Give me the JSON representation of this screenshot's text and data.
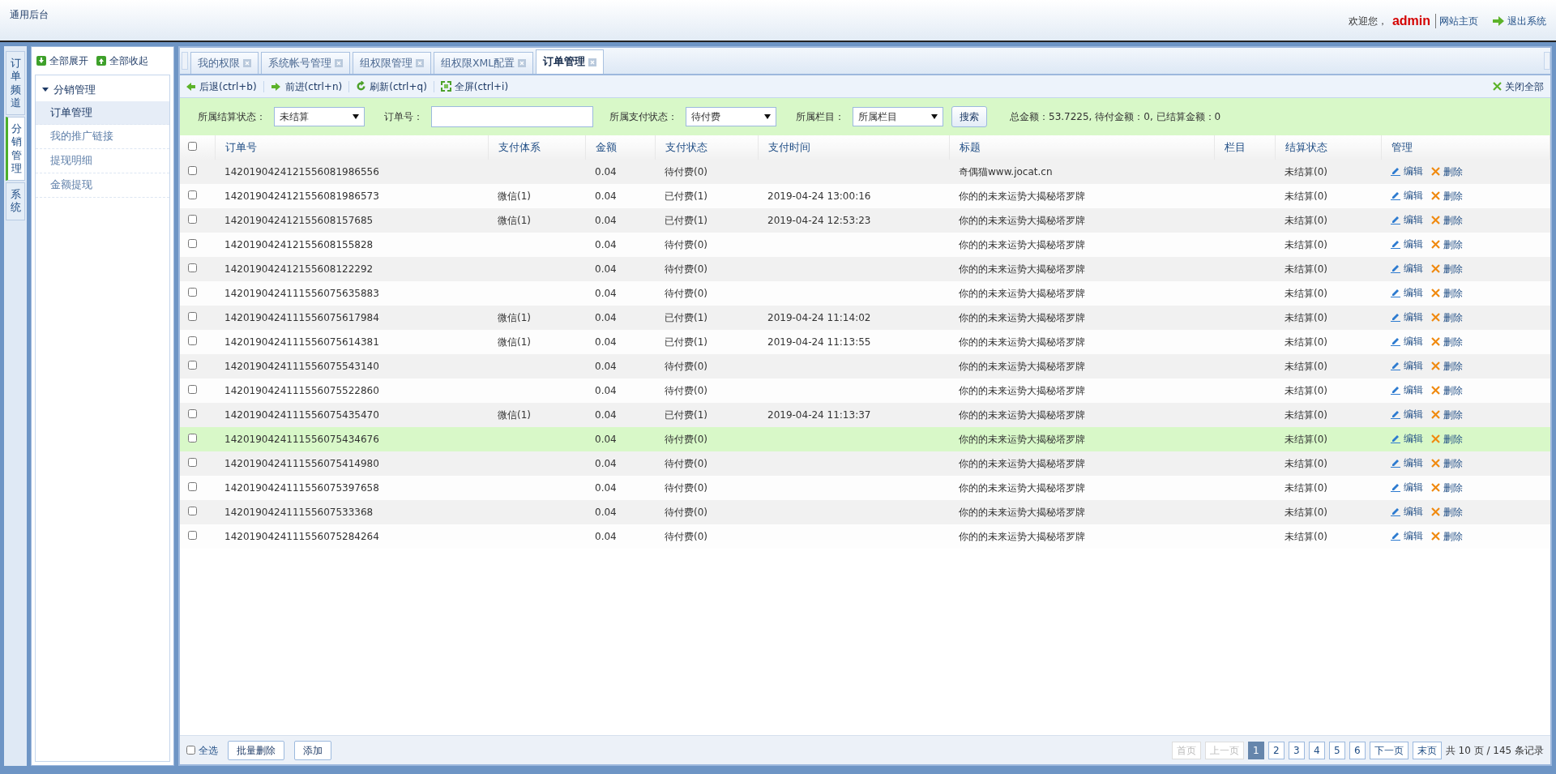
{
  "header": {
    "title": "通用后台",
    "welcome": "欢迎您，",
    "user": "admin",
    "links": [
      {
        "label": "网站主页",
        "kind": "home"
      },
      {
        "label": "退出系统",
        "kind": "logout"
      }
    ]
  },
  "side_tabs": [
    {
      "label": "订单频道",
      "selected": false
    },
    {
      "label": "分销管理",
      "selected": true
    },
    {
      "label": "系统",
      "selected": false
    }
  ],
  "tree": {
    "actions": [
      {
        "label": "全部展开",
        "kind": "expand"
      },
      {
        "label": "全部收起",
        "kind": "collapse"
      }
    ],
    "items": [
      {
        "label": "分销管理",
        "expanded": true,
        "children": [
          {
            "label": "订单管理",
            "selected": true
          },
          {
            "label": "我的推广链接",
            "selected": false
          },
          {
            "label": "提现明细",
            "selected": false
          },
          {
            "label": "金额提现",
            "selected": false
          }
        ]
      }
    ]
  },
  "tabs": [
    {
      "label": "我的权限",
      "selected": false
    },
    {
      "label": "系统帐号管理",
      "selected": false
    },
    {
      "label": "组权限管理",
      "selected": false
    },
    {
      "label": "组权限XML配置",
      "selected": false
    },
    {
      "label": "订单管理",
      "selected": true
    }
  ],
  "toolbar": [
    {
      "label": "后退(ctrl+b)",
      "kind": "back"
    },
    {
      "label": "前进(ctrl+n)",
      "kind": "forward"
    },
    {
      "label": "刷新(ctrl+q)",
      "kind": "refresh"
    },
    {
      "label": "全屏(ctrl+i)",
      "kind": "fullscreen"
    }
  ],
  "close_all": "关闭全部",
  "filters": [
    {
      "label": "所属结算状态：",
      "kind": "select",
      "value": "未结算"
    },
    {
      "label": "订单号：",
      "kind": "input"
    },
    {
      "label": "所属支付状态：",
      "kind": "select",
      "value": "待付费"
    },
    {
      "label": "所属栏目：",
      "kind": "select",
      "value": "所属栏目"
    }
  ],
  "search_button": "搜索",
  "summary": "总金额：53.7225, 待付金额：0, 已结算金额：0",
  "table": {
    "header_checked": false,
    "columns": [
      "订单号",
      "支付体系",
      "金额",
      "支付状态",
      "支付时间",
      "标题",
      "栏目",
      "结算状态",
      "管理"
    ],
    "rows": [
      {
        "checked": false,
        "highlighted": false,
        "cells": [
          "1420190424121556081986556",
          "",
          "0.04",
          "待付费(0)",
          "",
          "奇偶猫www.jocat.cn",
          "",
          "未结算(0)"
        ],
        "actions": [
          {
            "label": "编辑",
            "kind": "edit"
          },
          {
            "label": "删除",
            "kind": "delete"
          }
        ]
      },
      {
        "checked": false,
        "highlighted": false,
        "cells": [
          "1420190424121556081986573",
          "微信(1)",
          "0.04",
          "已付费(1)",
          "2019-04-24 13:00:16",
          "你的的未来运势大揭秘塔罗牌",
          "",
          "未结算(0)"
        ],
        "actions": [
          {
            "label": "编辑",
            "kind": "edit"
          },
          {
            "label": "删除",
            "kind": "delete"
          }
        ]
      },
      {
        "checked": false,
        "highlighted": false,
        "cells": [
          "142019042412155608157685",
          "微信(1)",
          "0.04",
          "已付费(1)",
          "2019-04-24 12:53:23",
          "你的的未来运势大揭秘塔罗牌",
          "",
          "未结算(0)"
        ],
        "actions": [
          {
            "label": "编辑",
            "kind": "edit"
          },
          {
            "label": "删除",
            "kind": "delete"
          }
        ]
      },
      {
        "checked": false,
        "highlighted": false,
        "cells": [
          "142019042412155608155828",
          "",
          "0.04",
          "待付费(0)",
          "",
          "你的的未来运势大揭秘塔罗牌",
          "",
          "未结算(0)"
        ],
        "actions": [
          {
            "label": "编辑",
            "kind": "edit"
          },
          {
            "label": "删除",
            "kind": "delete"
          }
        ]
      },
      {
        "checked": false,
        "highlighted": false,
        "cells": [
          "142019042412155608122292",
          "",
          "0.04",
          "待付费(0)",
          "",
          "你的的未来运势大揭秘塔罗牌",
          "",
          "未结算(0)"
        ],
        "actions": [
          {
            "label": "编辑",
            "kind": "edit"
          },
          {
            "label": "删除",
            "kind": "delete"
          }
        ]
      },
      {
        "checked": false,
        "highlighted": false,
        "cells": [
          "1420190424111556075635883",
          "",
          "0.04",
          "待付费(0)",
          "",
          "你的的未来运势大揭秘塔罗牌",
          "",
          "未结算(0)"
        ],
        "actions": [
          {
            "label": "编辑",
            "kind": "edit"
          },
          {
            "label": "删除",
            "kind": "delete"
          }
        ]
      },
      {
        "checked": false,
        "highlighted": false,
        "cells": [
          "1420190424111556075617984",
          "微信(1)",
          "0.04",
          "已付费(1)",
          "2019-04-24 11:14:02",
          "你的的未来运势大揭秘塔罗牌",
          "",
          "未结算(0)"
        ],
        "actions": [
          {
            "label": "编辑",
            "kind": "edit"
          },
          {
            "label": "删除",
            "kind": "delete"
          }
        ]
      },
      {
        "checked": false,
        "highlighted": false,
        "cells": [
          "1420190424111556075614381",
          "微信(1)",
          "0.04",
          "已付费(1)",
          "2019-04-24 11:13:55",
          "你的的未来运势大揭秘塔罗牌",
          "",
          "未结算(0)"
        ],
        "actions": [
          {
            "label": "编辑",
            "kind": "edit"
          },
          {
            "label": "删除",
            "kind": "delete"
          }
        ]
      },
      {
        "checked": false,
        "highlighted": false,
        "cells": [
          "1420190424111556075543140",
          "",
          "0.04",
          "待付费(0)",
          "",
          "你的的未来运势大揭秘塔罗牌",
          "",
          "未结算(0)"
        ],
        "actions": [
          {
            "label": "编辑",
            "kind": "edit"
          },
          {
            "label": "删除",
            "kind": "delete"
          }
        ]
      },
      {
        "checked": false,
        "highlighted": false,
        "cells": [
          "1420190424111556075522860",
          "",
          "0.04",
          "待付费(0)",
          "",
          "你的的未来运势大揭秘塔罗牌",
          "",
          "未结算(0)"
        ],
        "actions": [
          {
            "label": "编辑",
            "kind": "edit"
          },
          {
            "label": "删除",
            "kind": "delete"
          }
        ]
      },
      {
        "checked": false,
        "highlighted": false,
        "cells": [
          "1420190424111556075435470",
          "微信(1)",
          "0.04",
          "已付费(1)",
          "2019-04-24 11:13:37",
          "你的的未来运势大揭秘塔罗牌",
          "",
          "未结算(0)"
        ],
        "actions": [
          {
            "label": "编辑",
            "kind": "edit"
          },
          {
            "label": "删除",
            "kind": "delete"
          }
        ]
      },
      {
        "checked": false,
        "highlighted": true,
        "cells": [
          "1420190424111556075434676",
          "",
          "0.04",
          "待付费(0)",
          "",
          "你的的未来运势大揭秘塔罗牌",
          "",
          "未结算(0)"
        ],
        "actions": [
          {
            "label": "编辑",
            "kind": "edit"
          },
          {
            "label": "删除",
            "kind": "delete"
          }
        ]
      },
      {
        "checked": false,
        "highlighted": false,
        "cells": [
          "1420190424111556075414980",
          "",
          "0.04",
          "待付费(0)",
          "",
          "你的的未来运势大揭秘塔罗牌",
          "",
          "未结算(0)"
        ],
        "actions": [
          {
            "label": "编辑",
            "kind": "edit"
          },
          {
            "label": "删除",
            "kind": "delete"
          }
        ]
      },
      {
        "checked": false,
        "highlighted": false,
        "cells": [
          "1420190424111556075397658",
          "",
          "0.04",
          "待付费(0)",
          "",
          "你的的未来运势大揭秘塔罗牌",
          "",
          "未结算(0)"
        ],
        "actions": [
          {
            "label": "编辑",
            "kind": "edit"
          },
          {
            "label": "删除",
            "kind": "delete"
          }
        ]
      },
      {
        "checked": false,
        "highlighted": false,
        "cells": [
          "142019042411155607533368",
          "",
          "0.04",
          "待付费(0)",
          "",
          "你的的未来运势大揭秘塔罗牌",
          "",
          "未结算(0)"
        ],
        "actions": [
          {
            "label": "编辑",
            "kind": "edit"
          },
          {
            "label": "删除",
            "kind": "delete"
          }
        ]
      },
      {
        "checked": false,
        "highlighted": false,
        "cells": [
          "1420190424111556075284264",
          "",
          "0.04",
          "待付费(0)",
          "",
          "你的的未来运势大揭秘塔罗牌",
          "",
          "未结算(0)"
        ],
        "actions": [
          {
            "label": "编辑",
            "kind": "edit"
          },
          {
            "label": "删除",
            "kind": "delete"
          }
        ]
      }
    ]
  },
  "footer": {
    "select_all": {
      "label": "全选",
      "checked": false
    },
    "buttons": [
      "批量删除",
      "添加"
    ],
    "pages": [
      {
        "label": "首页",
        "disabled": true,
        "selected": false
      },
      {
        "label": "上一页",
        "disabled": true,
        "selected": false
      },
      {
        "label": "1",
        "disabled": false,
        "selected": true
      },
      {
        "label": "2",
        "disabled": false,
        "selected": false
      },
      {
        "label": "3",
        "disabled": false,
        "selected": false
      },
      {
        "label": "4",
        "disabled": false,
        "selected": false
      },
      {
        "label": "5",
        "disabled": false,
        "selected": false
      },
      {
        "label": "6",
        "disabled": false,
        "selected": false
      },
      {
        "label": "下一页",
        "disabled": false,
        "selected": false
      },
      {
        "label": "末页",
        "disabled": false,
        "selected": false
      }
    ],
    "page_info": "共 10 页 / 145 条记录"
  }
}
